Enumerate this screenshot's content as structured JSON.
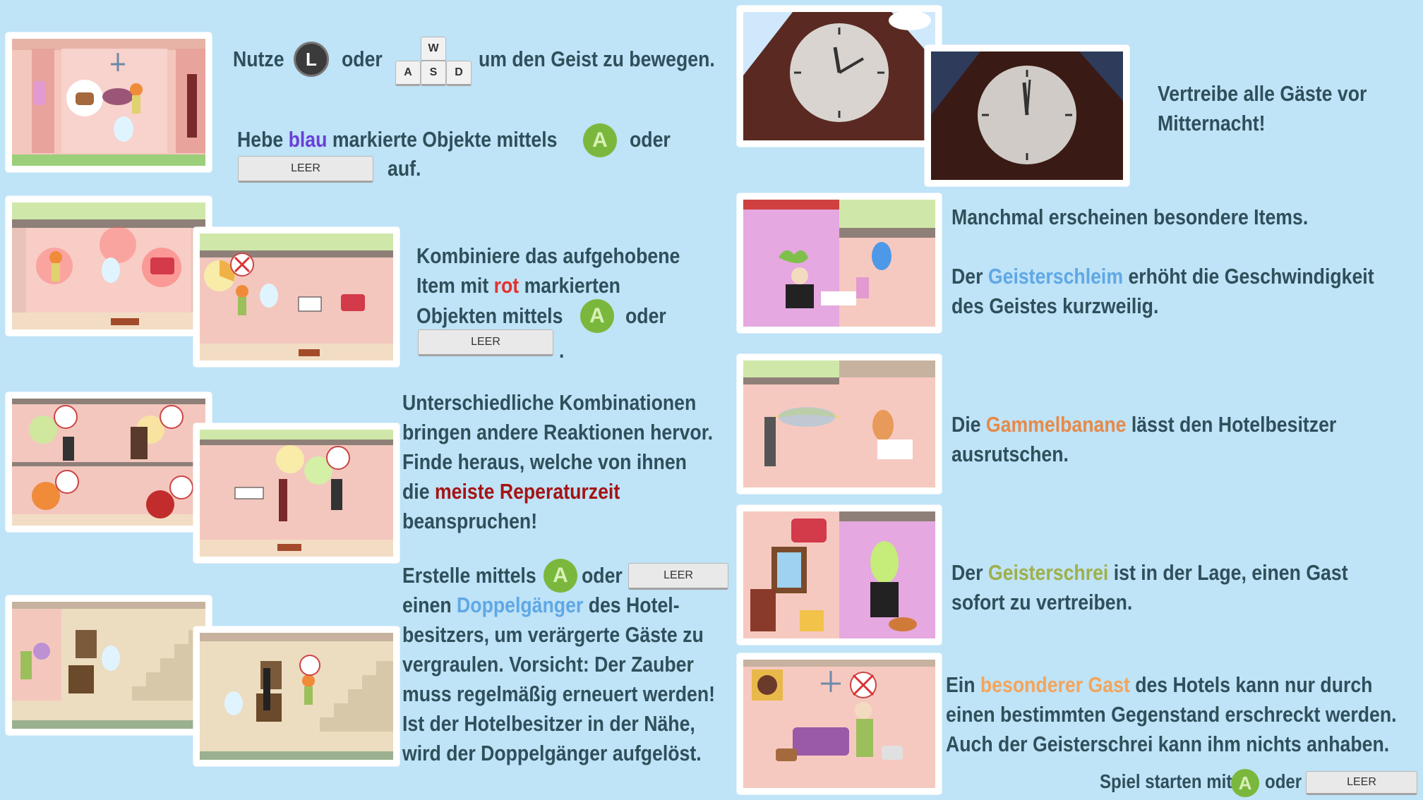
{
  "controls": {
    "stick_label": "L",
    "a_label": "A",
    "keys": {
      "w": "W",
      "a": "A",
      "s": "S",
      "d": "D"
    },
    "space_label": "LEER"
  },
  "section_move": {
    "word1": "Nutze",
    "word2": "oder",
    "rest": "um den Geist zu bewegen."
  },
  "section_pickup": {
    "p1": "Hebe",
    "hl": "blau",
    "p2": "markierte Objekte mittels",
    "p3": "oder",
    "p4": "auf."
  },
  "section_combine": {
    "line1": "Kombiniere das aufgehobene",
    "line2_a": "Item mit",
    "line2_hl": "rot",
    "line2_b": "markierten",
    "line3_a": "Objekten mittels",
    "line3_b": "oder",
    "end": "."
  },
  "section_reactions": {
    "line1": "Unterschiedliche Kombinationen",
    "line2": "bringen andere Reaktionen hervor.",
    "line3": "Finde heraus, welche von ihnen",
    "line4_a": "die",
    "line4_hl": "meiste Reperaturzeit",
    "line5": "beanspruchen!"
  },
  "section_double": {
    "line1_a": "Erstelle mittels",
    "line1_b": "oder",
    "line2_a": "einen",
    "line2_hl": "Doppelgänger",
    "line2_b": "des Hotel-",
    "line3": "besitzers, um verärgerte Gäste zu",
    "line4": "vergraulen. Vorsicht: Der Zauber",
    "line5": "muss regelmäßig erneuert werden!",
    "line6": "Ist der Hotelbesitzer in der Nähe,",
    "line7": "wird der Doppelgänger aufgelöst."
  },
  "section_midnight": {
    "line1": "Vertreibe alle Gäste vor",
    "line2": "Mitternacht!"
  },
  "section_items": {
    "line1": "Manchmal erscheinen besondere Items.",
    "line2_a": "Der",
    "line2_hl": "Geisterschleim",
    "line2_b": "erhöht die Geschwindigkeit",
    "line3": "des Geistes kurzweilig."
  },
  "section_banana": {
    "line1_a": "Die",
    "line1_hl": "Gammelbanane",
    "line1_b": "lässt den Hotelbesitzer",
    "line2": "ausrutschen."
  },
  "section_scream": {
    "line1_a": "Der",
    "line1_hl": "Geisterschrei",
    "line1_b": "ist in der Lage, einen Gast",
    "line2": "sofort zu vertreiben."
  },
  "section_special": {
    "line1_a": "Ein",
    "line1_hl": "besonderer Gast",
    "line1_b": "des Hotels kann nur durch",
    "line2": "einen bestimmten Gegenstand erschreckt werden.",
    "line3": "Auch der Geisterschrei kann ihm nichts anhaben."
  },
  "start": {
    "p1": "Spiel starten mit",
    "p2": "oder"
  },
  "colors": {
    "background": "#bfe3f7",
    "text": "#2f4f5a",
    "blue_highlight": "#6a3fd9",
    "red_highlight": "#e5302c",
    "dark_red_highlight": "#a41414",
    "light_blue_highlight": "#5fa8e6",
    "orange_highlight": "#e58a4a",
    "green_highlight": "#9fb04a",
    "peach_highlight": "#f3a55c",
    "a_button": "#7ab83d"
  }
}
